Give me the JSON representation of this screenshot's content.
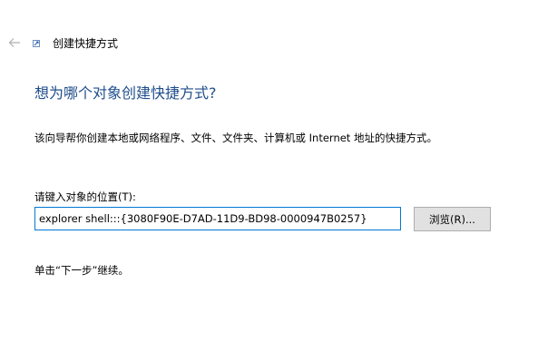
{
  "window": {
    "title": "创建快捷方式",
    "back_icon": "back-arrow-icon",
    "app_icon": "shortcut-app-icon"
  },
  "page": {
    "heading": "想为哪个对象创建快捷方式?",
    "description": "该向导帮你创建本地或网络程序、文件、文件夹、计算机或 Internet 地址的快捷方式。",
    "location_label": "请键入对象的位置(T):",
    "location_value": "explorer shell:::{3080F90E-D7AD-11D9-BD98-0000947B0257}",
    "browse_label": "浏览(R)...",
    "hint": "单击“下一步”继续。"
  },
  "colors": {
    "heading": "#1f4e8c",
    "input_border_focus": "#0078d7",
    "button_bg": "#e1e1e1",
    "button_border": "#adadad"
  }
}
